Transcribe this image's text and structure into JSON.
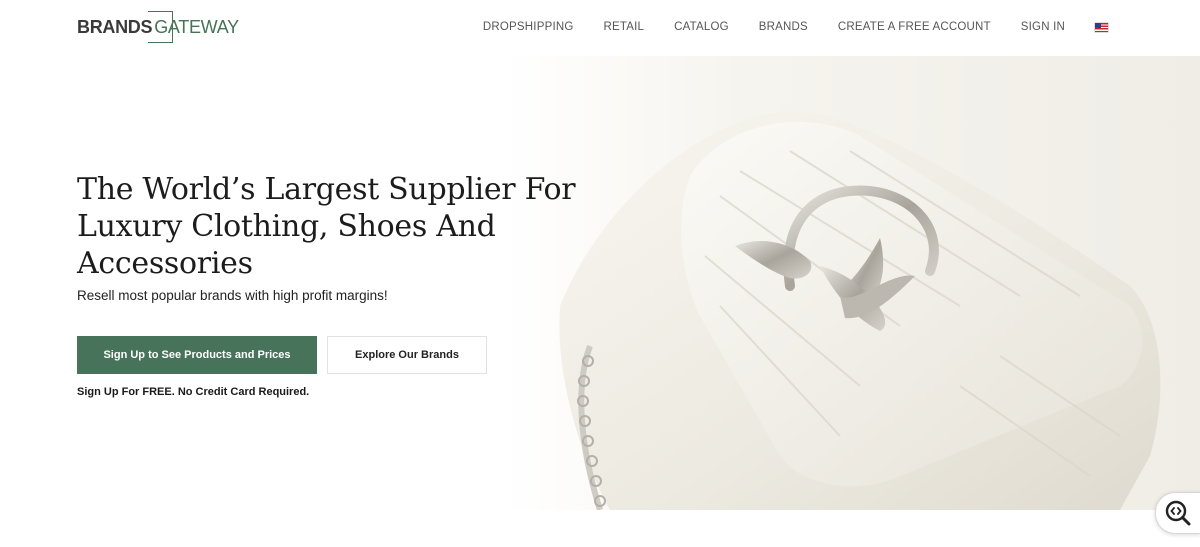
{
  "logo": {
    "part1": "BRANDS",
    "part2": "GATEWAY"
  },
  "nav": {
    "items": [
      "DROPSHIPPING",
      "RETAIL",
      "CATALOG",
      "BRANDS",
      "CREATE A FREE ACCOUNT",
      "SIGN IN"
    ],
    "flag_icon": "us-flag-icon"
  },
  "hero": {
    "headline_line1": "The World’s Largest Supplier For",
    "headline_line2": "Luxury Clothing, Shoes And",
    "headline_line3": "Accessories",
    "subline": "Resell most popular brands with high profit margins!",
    "primary_button": "Sign Up to See Products and Prices",
    "secondary_button": "Explore Our Brands",
    "note": "Sign Up For FREE. No Credit Card Required."
  },
  "colors": {
    "brand_green": "#46735a",
    "text_dark": "#1c1c1c",
    "nav_text": "#555555"
  },
  "widgets": {
    "accessibility_icon": "accessibility-search-icon"
  }
}
